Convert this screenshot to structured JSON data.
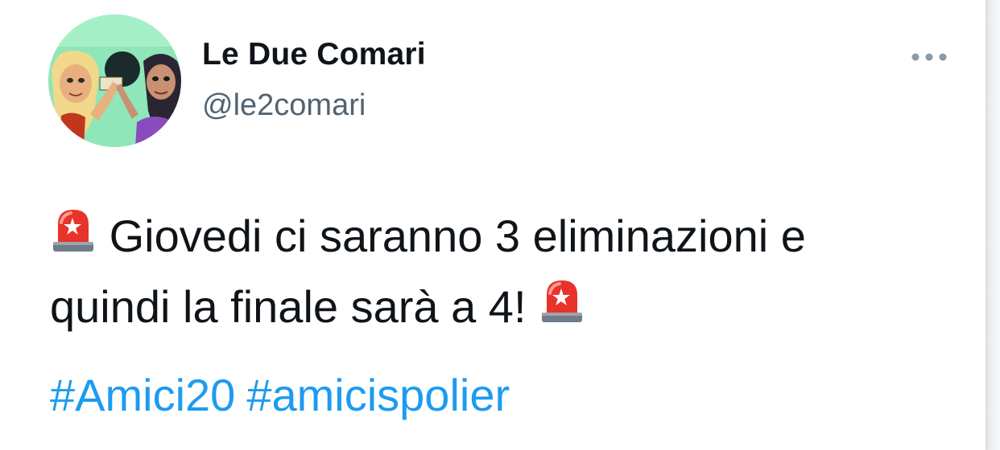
{
  "author": {
    "display_name": "Le Due Comari",
    "handle": "@le2comari",
    "avatar_icon": "avatar-illustration"
  },
  "more_button": {
    "icon": "more-horizontal-icon"
  },
  "tweet": {
    "line1_text": "Giovedi ci saranno 3 eliminazioni e",
    "line2_text": "quindi la finale sarà a 4!",
    "emoji_icon": "police-siren-icon",
    "hashtags": [
      "#Amici20",
      "#amicispolier"
    ]
  },
  "colors": {
    "hashtag": "#1d9bf0",
    "handle": "#536471",
    "text": "#0f1419",
    "more_dots": "#8b98a5"
  }
}
